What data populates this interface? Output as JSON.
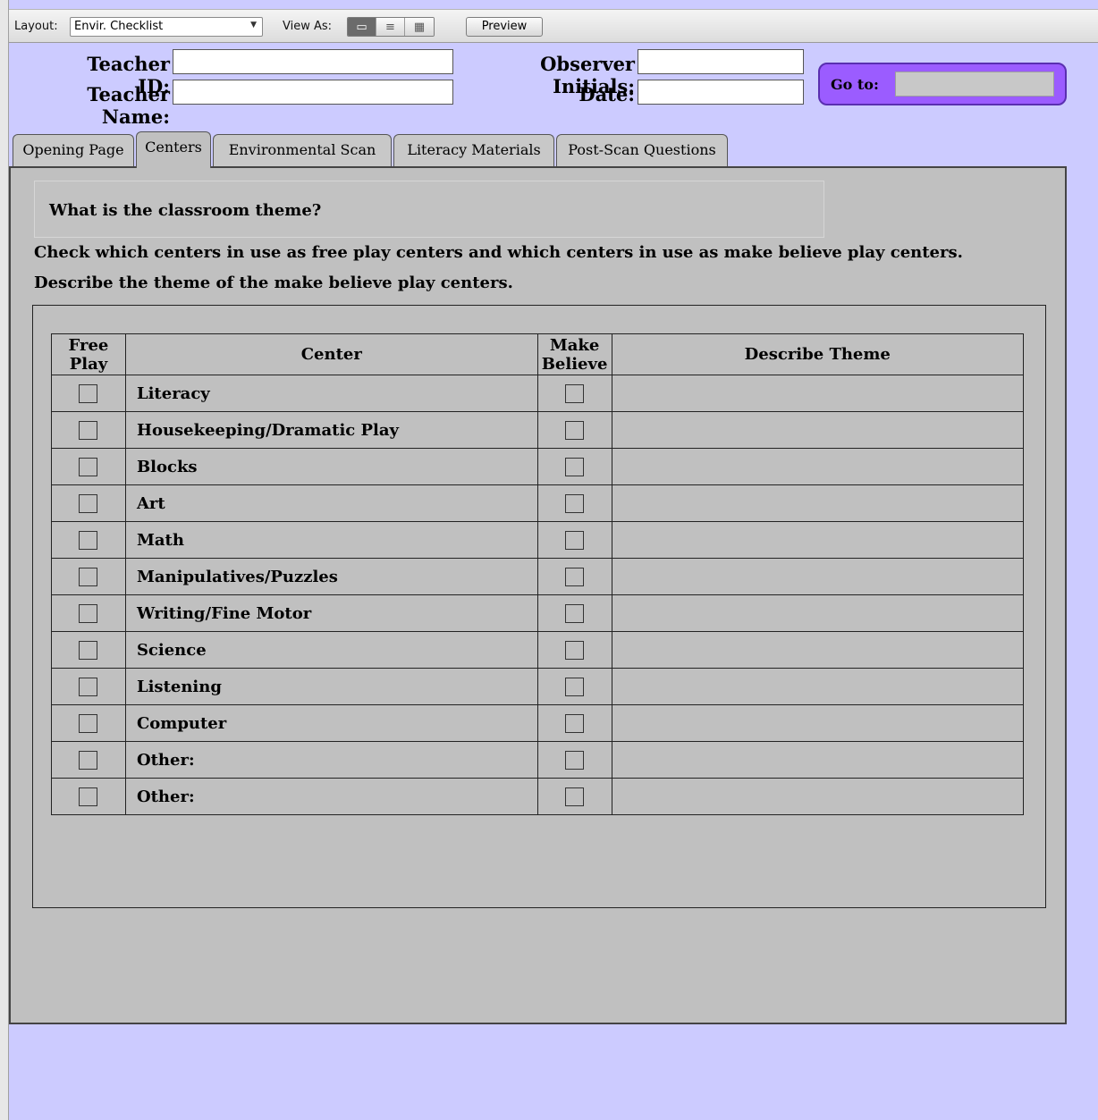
{
  "toolbar": {
    "layout_label": "Layout:",
    "layout_value": "Envir. Checklist",
    "view_as_label": "View As:",
    "view_icons": [
      "form-view-icon",
      "list-view-icon",
      "table-view-icon"
    ],
    "preview_label": "Preview"
  },
  "header": {
    "teacher_id_label": "Teacher ID:",
    "observer_initials_label": "Observer Initials:",
    "teacher_name_label": "Teacher Name:",
    "date_label": "Date:",
    "goto_label": "Go to:"
  },
  "tabs": [
    {
      "label": "Opening Page"
    },
    {
      "label": "Centers"
    },
    {
      "label": "Environmental Scan"
    },
    {
      "label": "Literacy Materials"
    },
    {
      "label": "Post-Scan Questions"
    }
  ],
  "active_tab": "Centers",
  "content": {
    "theme_question": "What is the classroom theme?",
    "instruction_1": "Check which centers in use as free play centers and which centers in use as make believe play centers.",
    "instruction_2": "Describe the theme of the make believe play centers.",
    "table": {
      "headers": {
        "free_play_1": "Free",
        "free_play_2": "Play",
        "center": "Center",
        "make_believe_1": "Make",
        "make_believe_2": "Believe",
        "describe_theme": "Describe Theme"
      },
      "rows": [
        "Literacy",
        "Housekeeping/Dramatic Play",
        "Blocks",
        "Art",
        "Math",
        "Manipulatives/Puzzles",
        "Writing/Fine Motor",
        "Science",
        "Listening",
        "Computer",
        "Other:",
        "Other:"
      ]
    }
  },
  "colors": {
    "background": "#cccbff",
    "panel": "#c0c0c0",
    "goto_accent": "#9b5cff"
  }
}
